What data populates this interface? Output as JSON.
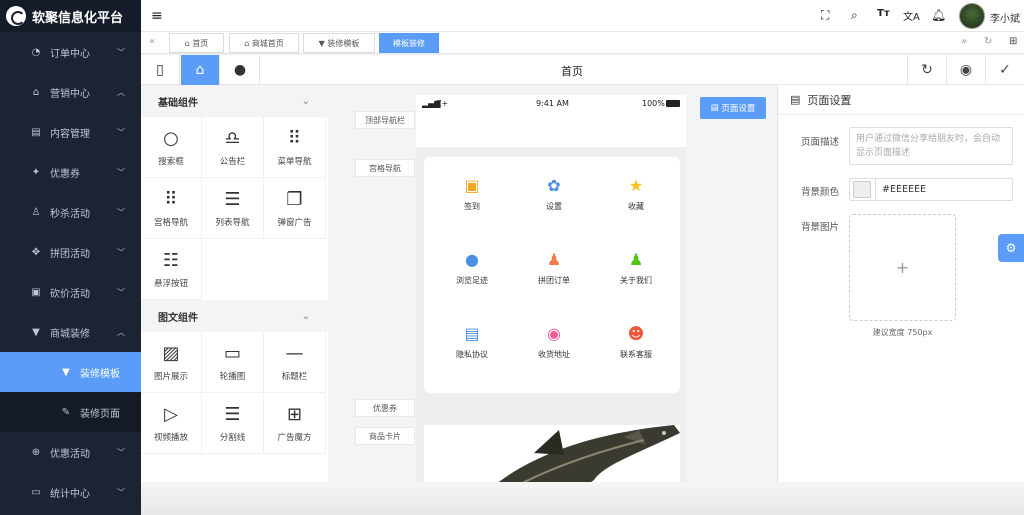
{
  "app": {
    "title": "软聚信息化平台",
    "user": "李小斌"
  },
  "sidebar": {
    "items": [
      {
        "label": "订单中心",
        "icon": "gauge-icon",
        "glyph": "◔",
        "level": 1
      },
      {
        "label": "营销中心",
        "icon": "shop-icon",
        "glyph": "⌂",
        "level": 1,
        "expanded": true
      },
      {
        "label": "内容管理",
        "icon": "document-icon",
        "glyph": "▤",
        "level": 2
      },
      {
        "label": "优惠券",
        "icon": "coupon-icon",
        "glyph": "✦",
        "level": 2
      },
      {
        "label": "秒杀活动",
        "icon": "user-icon",
        "glyph": "♙",
        "level": 2
      },
      {
        "label": "拼团活动",
        "icon": "group-icon",
        "glyph": "✥",
        "level": 2
      },
      {
        "label": "砍价活动",
        "icon": "cut-icon",
        "glyph": "▣",
        "level": 2
      },
      {
        "label": "商城装修",
        "icon": "brush-icon",
        "glyph": "▼",
        "level": 2,
        "expanded": true
      },
      {
        "label": "装修模板",
        "icon": "brush-icon",
        "glyph": "▼",
        "level": 3,
        "active": true
      },
      {
        "label": "装修页面",
        "icon": "edit-icon",
        "glyph": "✎",
        "level": 3
      },
      {
        "label": "优惠活动",
        "icon": "promo-icon",
        "glyph": "⊕",
        "level": 2
      },
      {
        "label": "统计中心",
        "icon": "chart-icon",
        "glyph": "▭",
        "level": 1
      }
    ]
  },
  "tabs": [
    {
      "label": "首页",
      "icon": "home-icon"
    },
    {
      "label": "商城首页",
      "icon": "home-icon"
    },
    {
      "label": "装修模板",
      "icon": "brush-icon"
    },
    {
      "label": "模板装修",
      "active": true
    }
  ],
  "toolbar": {
    "title": "首页"
  },
  "components": {
    "basic": {
      "title": "基础组件",
      "items": [
        {
          "label": "搜索框",
          "icon": "search-icon",
          "glyph": "○"
        },
        {
          "label": "公告栏",
          "icon": "bell-icon",
          "glyph": "♎"
        },
        {
          "label": "菜单导航",
          "icon": "grid-icon",
          "glyph": "⠿"
        },
        {
          "label": "宫格导航",
          "icon": "grid-icon",
          "glyph": "⠿"
        },
        {
          "label": "列表导航",
          "icon": "list-icon",
          "glyph": "☰"
        },
        {
          "label": "弹窗广告",
          "icon": "popup-icon",
          "glyph": "❐"
        },
        {
          "label": "悬浮按钮",
          "icon": "float-icon",
          "glyph": "☷"
        }
      ]
    },
    "media": {
      "title": "图文组件",
      "items": [
        {
          "label": "图片展示",
          "icon": "image-icon",
          "glyph": "▨"
        },
        {
          "label": "轮播图",
          "icon": "carousel-icon",
          "glyph": "▭"
        },
        {
          "label": "标题栏",
          "icon": "title-icon",
          "glyph": "—"
        },
        {
          "label": "视频播放",
          "icon": "video-icon",
          "glyph": "▷"
        },
        {
          "label": "分割线",
          "icon": "divider-icon",
          "glyph": "☰"
        },
        {
          "label": "广告魔方",
          "icon": "cube-icon",
          "glyph": "⊞"
        }
      ]
    }
  },
  "phone": {
    "carrier": "Z+",
    "time": "9:41 AM",
    "battery": "100%",
    "labels": [
      "顶部导航栏",
      "宫格导航",
      "优惠券",
      "商品卡片"
    ],
    "grid_nav": [
      {
        "label": "签到",
        "icon": "calendar-icon",
        "color": "#f5a623"
      },
      {
        "label": "设置",
        "icon": "settings-icon",
        "color": "#4a90e2"
      },
      {
        "label": "收藏",
        "icon": "star-icon",
        "color": "#f8c11c"
      },
      {
        "label": "浏览足迹",
        "icon": "footprint-icon",
        "color": "#4a90e2"
      },
      {
        "label": "拼团订单",
        "icon": "team-icon",
        "color": "#f07c4a"
      },
      {
        "label": "关于我们",
        "icon": "about-icon",
        "color": "#52c41a"
      },
      {
        "label": "隐私协议",
        "icon": "privacy-icon",
        "color": "#4a90e2"
      },
      {
        "label": "收货地址",
        "icon": "location-icon",
        "color": "#ee5e9f"
      },
      {
        "label": "联系客服",
        "icon": "service-icon",
        "color": "#f0563c"
      }
    ],
    "page_settings_button": "页面设置"
  },
  "settings": {
    "title": "页面设置",
    "desc_label": "页面描述",
    "desc_placeholder": "用户通过微信分享给朋友时，会自动显示页面描述",
    "bg_color_label": "背景颜色",
    "bg_color_value": "#EEEEEE",
    "bg_image_label": "背景图片",
    "bg_image_hint": "建议宽度 750px"
  }
}
